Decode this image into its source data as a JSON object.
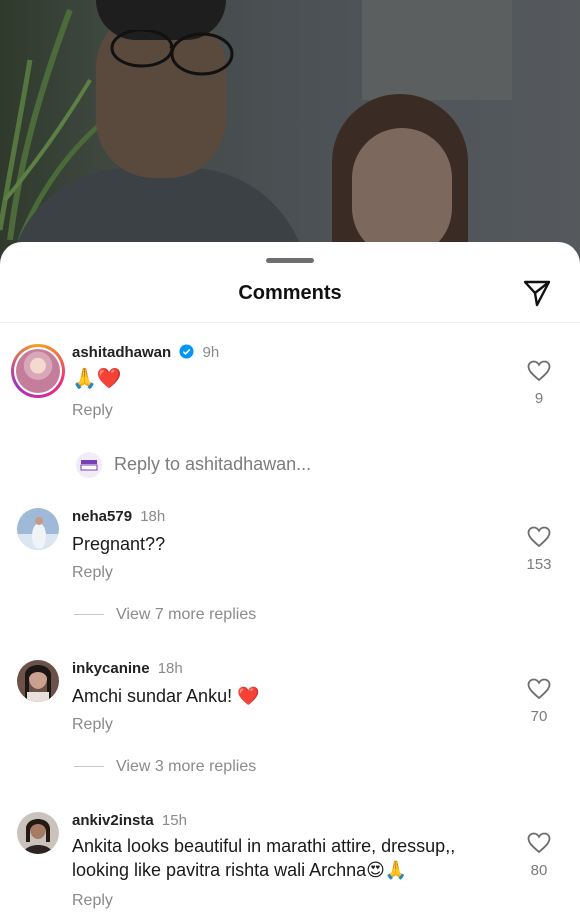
{
  "sheet": {
    "title": "Comments"
  },
  "comments": [
    {
      "username": "ashitadhawan",
      "verified": true,
      "time": "9h",
      "text": "🙏❤️",
      "reply_label": "Reply",
      "likes": "9",
      "reply_to_prompt": "Reply to ashitadhawan..."
    },
    {
      "username": "neha579",
      "time": "18h",
      "text": "Pregnant??",
      "reply_label": "Reply",
      "likes": "153",
      "more_replies": "View 7 more replies"
    },
    {
      "username": "inkycanine",
      "time": "18h",
      "text": "Amchi sundar Anku! ❤️",
      "reply_label": "Reply",
      "likes": "70",
      "more_replies": "View 3 more replies"
    },
    {
      "username": "ankiv2insta",
      "time": "15h",
      "text_line1": "Ankita looks beautiful in marathi attire, dressup,,",
      "text_line2": "looking like pavitra rishta wali Archna😍🙏",
      "reply_label": "Reply",
      "likes": "80"
    }
  ],
  "icons": {
    "share": "paper-plane-icon",
    "like": "heart-outline-icon",
    "verified": "verified-badge-icon"
  },
  "colors": {
    "verified_blue": "#0095f6",
    "muted_text": "#8a8a8a",
    "story_ring": "#ee2a7b"
  }
}
